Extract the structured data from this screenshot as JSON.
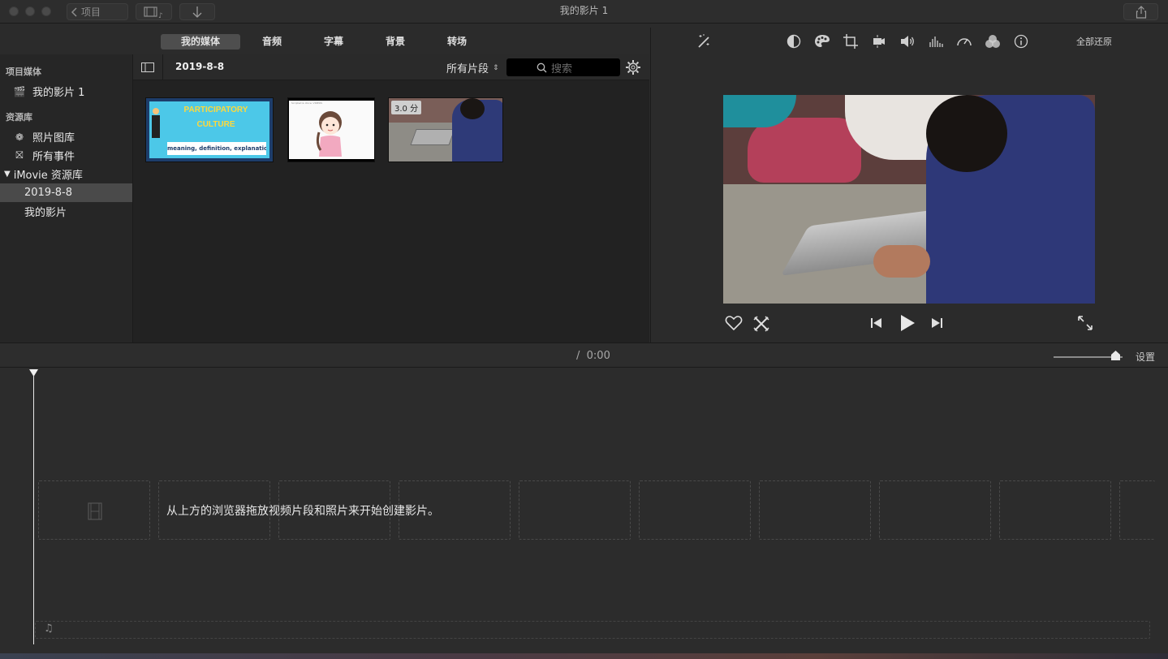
{
  "window": {
    "title": "我的影片 1"
  },
  "toolbar": {
    "back_label": "项目",
    "back_icon": "chevron-left-icon",
    "media_icon": "film-music-icon",
    "import_icon": "arrow-down-icon",
    "share_icon": "share-icon"
  },
  "tabs": [
    {
      "label": "我的媒体",
      "active": true
    },
    {
      "label": "音频",
      "active": false
    },
    {
      "label": "字幕",
      "active": false
    },
    {
      "label": "背景",
      "active": false
    },
    {
      "label": "转场",
      "active": false
    }
  ],
  "sidebar": {
    "project_media_header": "项目媒体",
    "project_item": "我的影片 1",
    "libraries_header": "资源库",
    "photos_library": "照片图库",
    "all_events": "所有事件",
    "imovie_library": "iMovie 资源库",
    "event_item": "2019-8-8",
    "my_movie": "我的影片"
  },
  "browser": {
    "event_title": "2019-8-8",
    "filter_label": "所有片段",
    "search_placeholder": "搜索",
    "clips": [
      {
        "name": "participatory-culture",
        "line1": "PARTICIPATORY",
        "line2": "CULTURE",
        "caption": "meaning, definition, explanation..."
      },
      {
        "name": "cartoon-girl",
        "caption": "Scripted & Voice: VIDEOS"
      },
      {
        "name": "boy-laptop",
        "duration": "3.0 分"
      }
    ]
  },
  "viewer": {
    "reset_all": "全部还原",
    "tools": [
      "magic-wand-icon",
      "color-balance-icon",
      "palette-icon",
      "crop-icon",
      "stabilization-icon",
      "volume-icon",
      "equalizer-icon",
      "speed-icon",
      "noise-reduction-icon",
      "info-icon"
    ]
  },
  "timeline": {
    "time": "/  0:00",
    "settings_label": "设置",
    "placeholder_text": "从上方的浏览器拖放视频片段和照片来开始创建影片。",
    "zoom_level": 0.9
  }
}
